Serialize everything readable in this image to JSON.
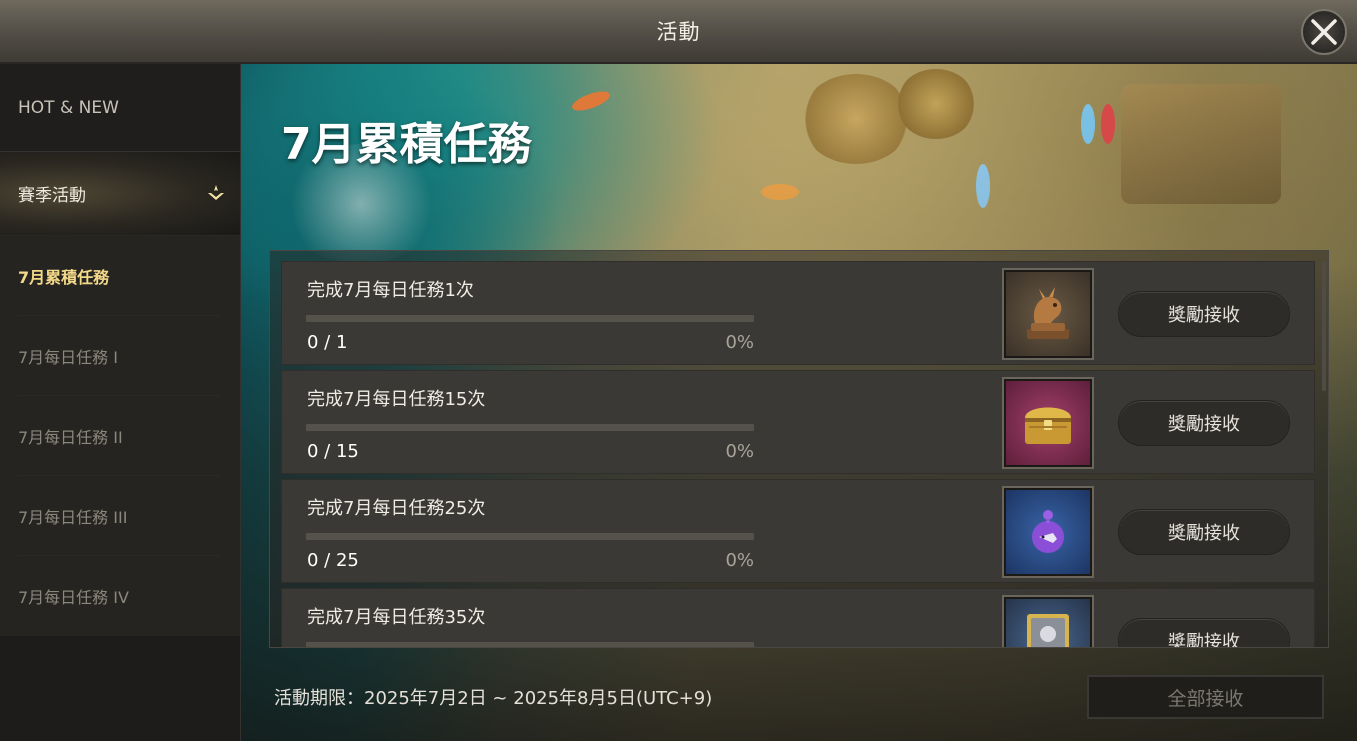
{
  "window": {
    "title": "活動"
  },
  "sidebar": {
    "hot_new": "HOT & NEW",
    "season": "賽季活動",
    "items": [
      {
        "label": "7月累積任務",
        "active": true
      },
      {
        "label": "7月每日任務 I",
        "active": false
      },
      {
        "label": "7月每日任務 II",
        "active": false
      },
      {
        "label": "7月每日任務 III",
        "active": false
      },
      {
        "label": "7月每日任務 IV",
        "active": false
      }
    ]
  },
  "main": {
    "title": "7月累積任務",
    "tasks": [
      {
        "label": "完成7月每日任務1次",
        "count": "0 / 1",
        "percent": "0%",
        "progress": 0,
        "reward_icon": "dragon-statue-icon",
        "button": "獎勵接收"
      },
      {
        "label": "完成7月每日任務15次",
        "count": "0 / 15",
        "percent": "0%",
        "progress": 0,
        "reward_icon": "golden-chest-icon",
        "button": "獎勵接收"
      },
      {
        "label": "完成7月每日任務25次",
        "count": "0 / 25",
        "percent": "0%",
        "progress": 0,
        "reward_icon": "purple-fish-bowl-icon",
        "button": "獎勵接收"
      },
      {
        "label": "完成7月每日任務35次",
        "count": "",
        "percent": "",
        "progress": 0,
        "reward_icon": "hero-card-icon",
        "button": "獎勵接收"
      }
    ],
    "period": "活動期限：2025年7月2日 ~ 2025年8月5日(UTC+9)",
    "claim_all": "全部接收"
  },
  "colors": {
    "accent_gold": "#f3d98a",
    "progress_fill": "#d9b56a",
    "panel_bg": "#3a3935"
  }
}
